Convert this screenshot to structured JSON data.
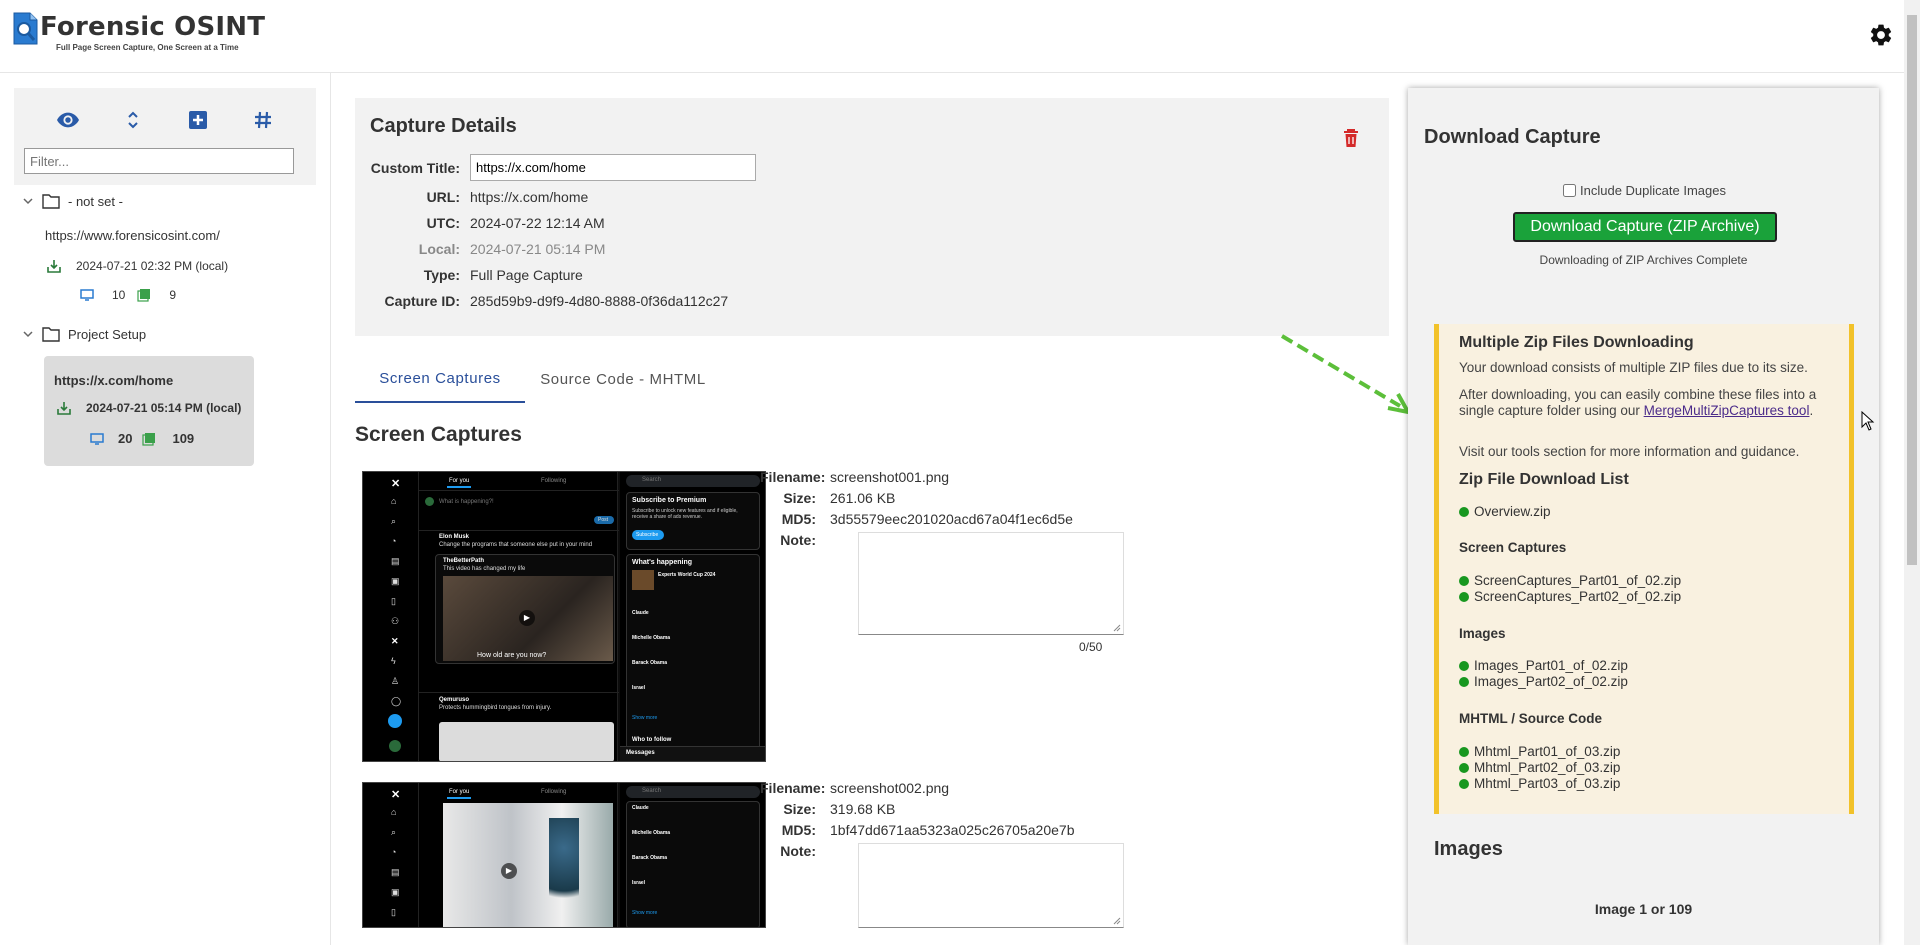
{
  "app": {
    "title": "Forensic OSINT",
    "tagline": "Full Page Screen Capture, One Screen at a Time"
  },
  "sidebar": {
    "filter_placeholder": "Filter...",
    "groups": [
      {
        "name": "- not set -",
        "items": [
          {
            "url": "https://www.forensicosint.com/",
            "time": "2024-07-21 02:32 PM (local)",
            "screens": "10",
            "images": "9"
          }
        ]
      },
      {
        "name": "Project Setup",
        "items": [
          {
            "url": "https://x.com/home",
            "time": "2024-07-21 05:14 PM (local)",
            "screens": "20",
            "images": "109"
          }
        ]
      }
    ]
  },
  "details": {
    "heading": "Capture Details",
    "custom_title_label": "Custom Title:",
    "custom_title_value": "https://x.com/home",
    "url_label": "URL:",
    "url_value": "https://x.com/home",
    "utc_label": "UTC:",
    "utc_value": "2024-07-22 12:14 AM",
    "local_label": "Local:",
    "local_value": "2024-07-21 05:14 PM",
    "type_label": "Type:",
    "type_value": "Full Page Capture",
    "id_label": "Capture ID:",
    "id_value": "285d59b9-d9f9-4d80-8888-0f36da112c27"
  },
  "tabs": [
    {
      "label": "Screen Captures",
      "active": true
    },
    {
      "label": "Source Code - MHTML",
      "active": false
    }
  ],
  "captures_heading": "Screen Captures",
  "captures": [
    {
      "filename_label": "Filename:",
      "filename": "screenshot001.png",
      "size_label": "Size:",
      "size": "261.06 KB",
      "md5_label": "MD5:",
      "md5": "3d55579eec201020acd67a04f1ec6d5e",
      "note_label": "Note:",
      "note_count": "0/50"
    },
    {
      "filename_label": "Filename:",
      "filename": "screenshot002.png",
      "size_label": "Size:",
      "size": "319.68 KB",
      "md5_label": "MD5:",
      "md5": "1bf47dd671aa5323a025c26705a20e7b",
      "note_label": "Note:"
    }
  ],
  "shot1": {
    "tab_for_you": "For you",
    "tab_following": "Following",
    "search": "Search",
    "whats_happening": "What is happening?!",
    "post_btn": "Post",
    "premium_title": "Subscribe to Premium",
    "premium_body": "Subscribe to unlock new features and if eligible, receive a share of ads revenue.",
    "subscribe": "Subscribe",
    "trend_head": "What's happening",
    "event": "Experts World Cup 2024",
    "trends": [
      "Claude",
      "Michelle Obama",
      "Barack Obama",
      "Israel"
    ],
    "show_more": "Show more",
    "who_to_follow": "Who to follow",
    "messages": "Messages",
    "video_caption": "How old are you now?",
    "user1": "Elon Musk",
    "user2": "TheBetterPath",
    "user3": "Qemuruso",
    "tweet_text": "Change the programs that someone else put in your mind",
    "sub_text": "This video has changed my life",
    "qem_text": "Protects hummingbird tongues from injury."
  },
  "shot2": {
    "tab_for_you": "For you",
    "tab_following": "Following",
    "search": "Search",
    "trends": [
      "Claude",
      "Michelle Obama",
      "Barack Obama",
      "Israel"
    ],
    "show_more": "Show more"
  },
  "download": {
    "heading": "Download Capture",
    "include_dup": "Include Duplicate Images",
    "button": "Download Capture (ZIP Archive)",
    "status": "Downloading of ZIP Archives Complete",
    "notice_title": "Multiple Zip Files Downloading",
    "notice_p1": "Your download consists of multiple ZIP files due to its size.",
    "notice_p2_pre": "After downloading, you can easily combine these files into a single capture folder using our ",
    "notice_p2_link": "MergeMultiZipCaptures tool",
    "notice_p2_post": ".",
    "notice_p3": "Visit our tools section for more information and guidance.",
    "list_title": "Zip File Download List",
    "overview": "Overview.zip",
    "screen_captures_label": "Screen Captures",
    "screen_zips": [
      "ScreenCaptures_Part01_of_02.zip",
      "ScreenCaptures_Part02_of_02.zip"
    ],
    "images_label": "Images",
    "image_zips": [
      "Images_Part01_of_02.zip",
      "Images_Part02_of_02.zip"
    ],
    "mhtml_label": "MHTML / Source Code",
    "mhtml_zips": [
      "Mhtml_Part01_of_03.zip",
      "Mhtml_Part02_of_03.zip",
      "Mhtml_Part03_of_03.zip"
    ],
    "images_heading": "Images",
    "image_counter": "Image 1 or 109"
  },
  "colors": {
    "accent": "#2a5ba8",
    "download_green": "#1aa23a",
    "status_dot": "#18971f",
    "notice_bg": "#f9f1e0",
    "notice_border": "#f2c22a",
    "trash_red": "#d42a2a"
  }
}
